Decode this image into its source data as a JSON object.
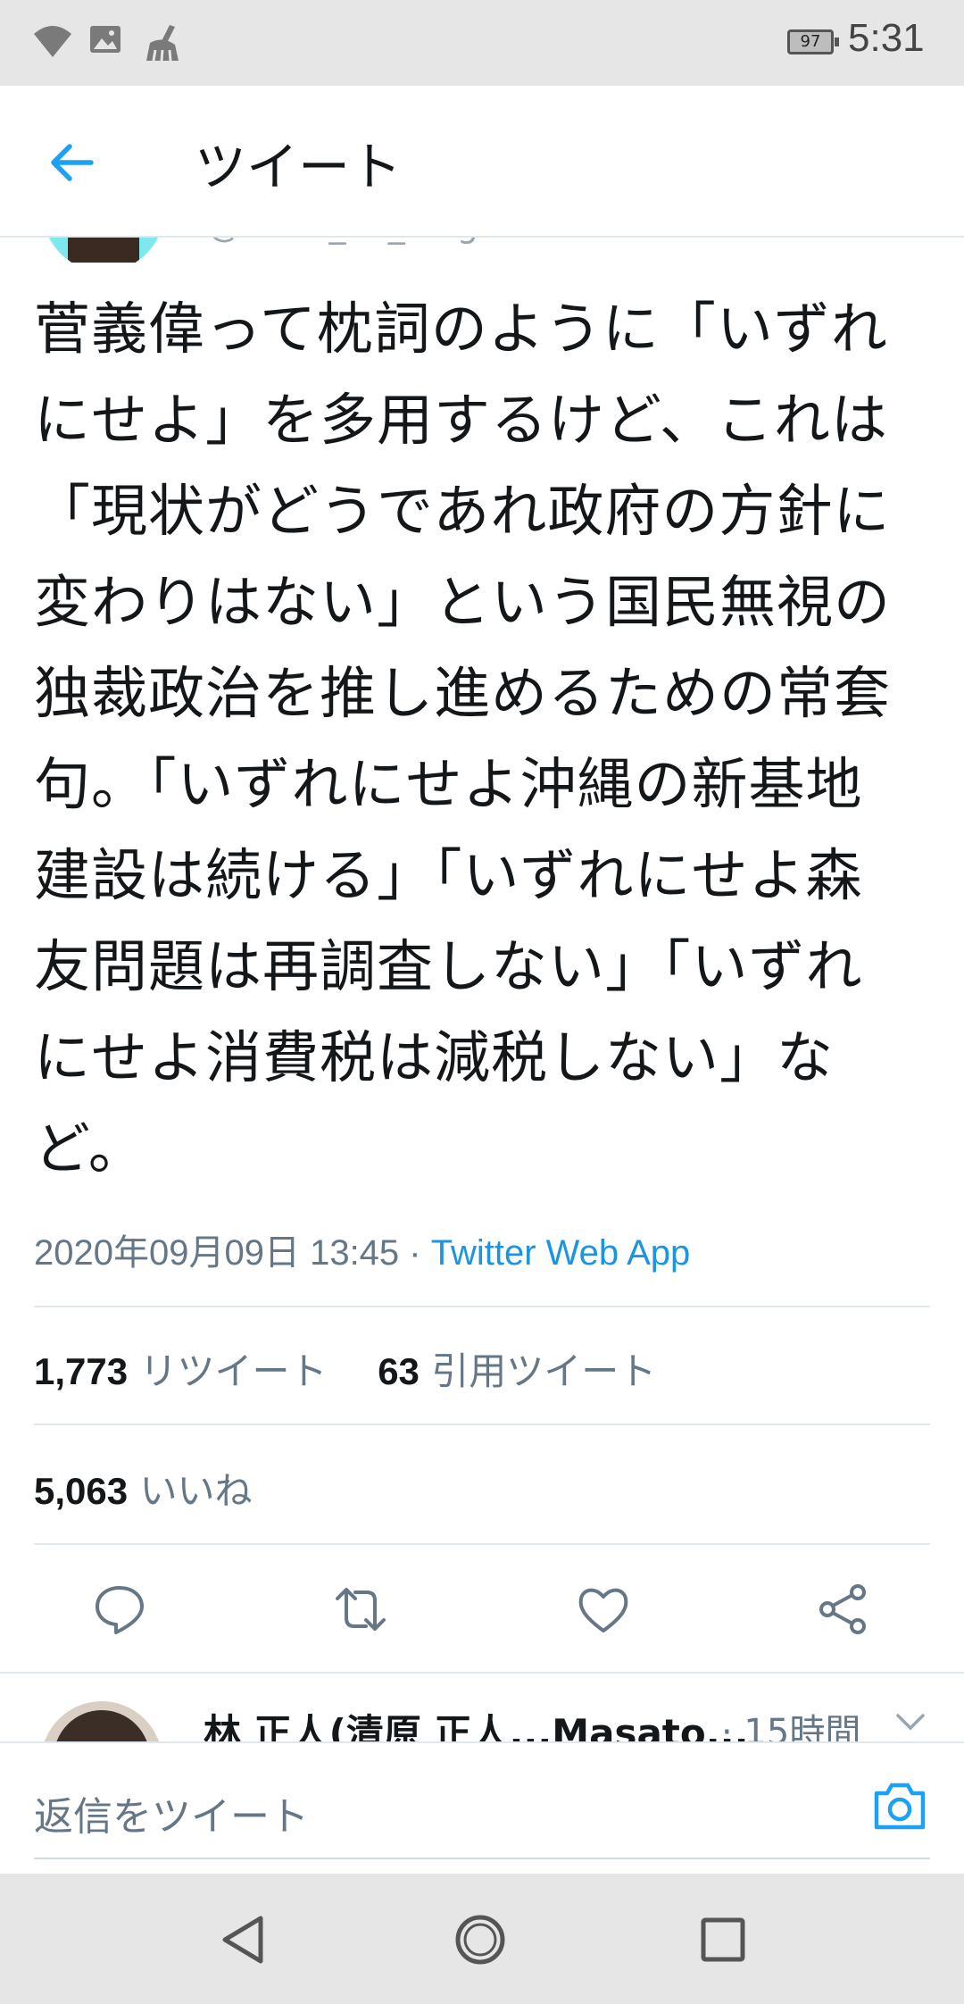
{
  "status_bar": {
    "battery": "97",
    "time": "5:31"
  },
  "header": {
    "title": "ツイート"
  },
  "author": {
    "handle": "@kikko_no_blog"
  },
  "tweet": {
    "lines": [
      "菅義偉って枕詞のように「いずれ",
      "にせよ」を多用するけど、これは",
      "「現状がどうであれ政府の方針に",
      "変わりはない」という国民無視の",
      "独裁政治を推し進めるための常套",
      "句。「いずれにせよ沖縄の新基地",
      "建設は続ける」「いずれにせよ森",
      "友問題は再調査しない」「いずれ",
      "にせよ消費税は減税しない」な",
      "ど。"
    ],
    "timestamp": "2020年09月09日 13:45",
    "separator": " · ",
    "source": "Twitter Web App"
  },
  "stats": {
    "retweets_count": "1,773",
    "retweets_label": "リツイート",
    "quotes_count": "63",
    "quotes_label": "引用ツイート",
    "likes_count": "5,063",
    "likes_label": "いいね"
  },
  "actions": {
    "icons": [
      "reply-icon",
      "retweet-icon",
      "like-icon",
      "share-icon"
    ]
  },
  "reply_preview": {
    "name": "林 正人(清原 正人...Masato...",
    "time": "· 15時間"
  },
  "compose": {
    "placeholder": "返信をツイート"
  },
  "colors": {
    "accent": "#1da1f2",
    "text": "#14171a",
    "secondary": "#657786",
    "divider": "#e1e8ed"
  }
}
